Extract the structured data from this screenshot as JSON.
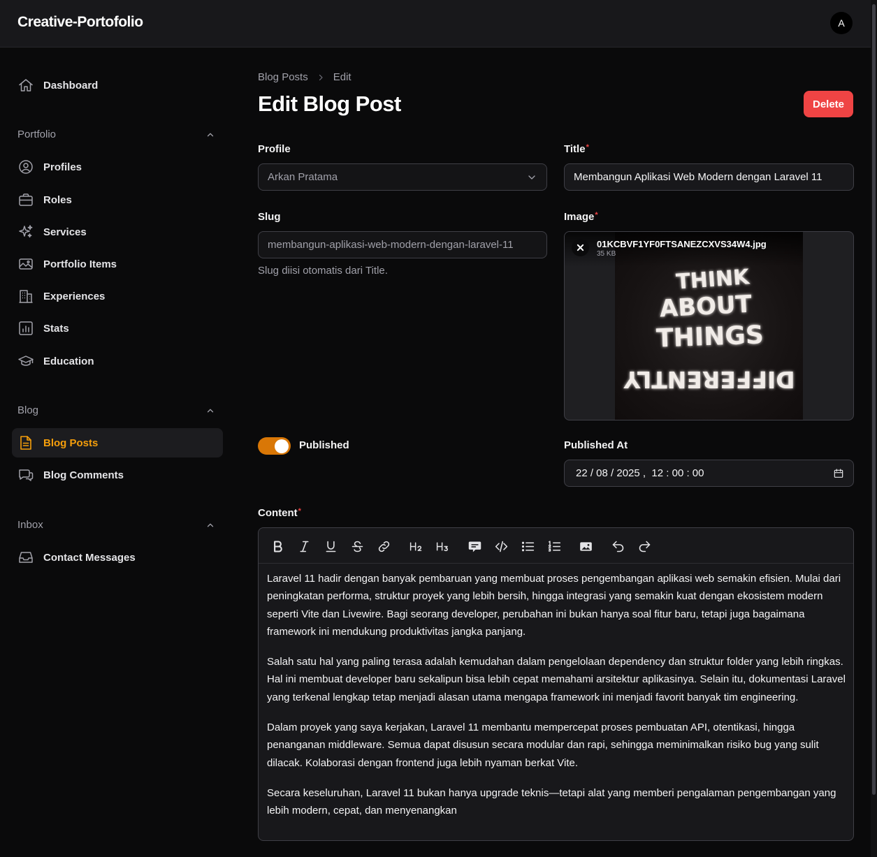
{
  "app": {
    "title": "Creative-Portofolio",
    "avatar_initial": "A"
  },
  "sidebar": {
    "dashboard": "Dashboard",
    "groups": [
      {
        "label": "Portfolio",
        "items": [
          "Profiles",
          "Roles",
          "Services",
          "Portfolio Items",
          "Experiences",
          "Stats",
          "Education"
        ]
      },
      {
        "label": "Blog",
        "items": [
          "Blog Posts",
          "Blog Comments"
        ]
      },
      {
        "label": "Inbox",
        "items": [
          "Contact Messages"
        ]
      }
    ],
    "active_item": "Blog Posts"
  },
  "breadcrumb": [
    "Blog Posts",
    "Edit"
  ],
  "page_title": "Edit Blog Post",
  "actions": {
    "delete_label": "Delete"
  },
  "form": {
    "profile": {
      "label": "Profile",
      "value": "Arkan Pratama"
    },
    "title": {
      "label": "Title",
      "value": "Membangun Aplikasi Web Modern dengan Laravel 11"
    },
    "slug": {
      "label": "Slug",
      "value": "membangun-aplikasi-web-modern-dengan-laravel-11",
      "hint": "Slug diisi otomatis dari Title."
    },
    "image": {
      "label": "Image",
      "file_name": "01KCBVF1YF0FTSANEZCXVS34W4.jpg",
      "file_size": "35 KB",
      "preview_text": [
        "THINK",
        "ABOUT",
        "THINGS",
        "DIFFERENTLY"
      ]
    },
    "published": {
      "label": "Published",
      "value": true
    },
    "published_at": {
      "label": "Published At",
      "value": "22 / 08 / 2025 ,  12 : 00 : 00"
    },
    "content": {
      "label": "Content",
      "toolbar": [
        "bold",
        "italic",
        "underline",
        "strikethrough",
        "link",
        "H2",
        "H3",
        "blockquote",
        "code-block",
        "bullet-list",
        "ordered-list",
        "attach-image",
        "undo",
        "redo"
      ],
      "paragraphs": [
        "Laravel 11 hadir dengan banyak pembaruan yang membuat proses pengembangan aplikasi web semakin efisien. Mulai dari peningkatan performa, struktur proyek yang lebih bersih, hingga integrasi yang semakin kuat dengan ekosistem modern seperti Vite dan Livewire. Bagi seorang developer, perubahan ini bukan hanya soal fitur baru, tetapi juga bagaimana framework ini mendukung produktivitas jangka panjang.",
        "Salah satu hal yang paling terasa adalah kemudahan dalam pengelolaan dependency dan struktur folder yang lebih ringkas. Hal ini membuat developer baru sekalipun bisa lebih cepat memahami arsitektur aplikasinya. Selain itu, dokumentasi Laravel yang terkenal lengkap tetap menjadi alasan utama mengapa framework ini menjadi favorit banyak tim engineering.",
        "Dalam proyek yang saya kerjakan, Laravel 11 membantu mempercepat proses pembuatan API, otentikasi, hingga penanganan middleware. Semua dapat disusun secara modular dan rapi, sehingga meminimalkan risiko bug yang sulit dilacak. Kolaborasi dengan frontend juga lebih nyaman berkat Vite.",
        "Secara keseluruhan, Laravel 11 bukan hanya upgrade teknis—tetapi alat yang memberi pengalaman pengembangan yang lebih modern, cepat, dan menyenangkan"
      ]
    }
  },
  "colors": {
    "accent": "#f59e0b",
    "danger": "#ef4444",
    "toggle_on": "#d97706"
  }
}
